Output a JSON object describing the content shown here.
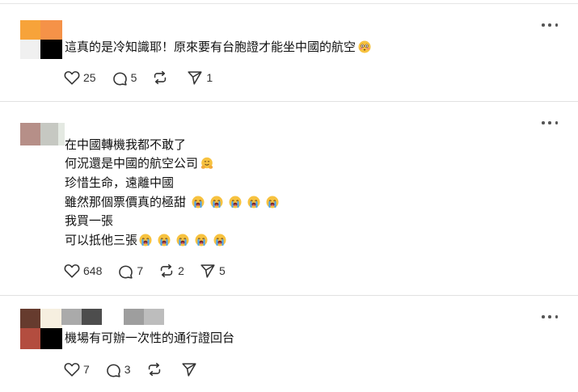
{
  "posts": [
    {
      "lines": [
        {
          "text": "這真的是冷知識耶！原來要有台胞證才能坐中國的航空",
          "emojis": [
            "flushed-face"
          ]
        }
      ],
      "counts": {
        "likes": "25",
        "replies": "5",
        "reposts": "",
        "shares": "1"
      }
    },
    {
      "lines": [
        {
          "text": "在中國轉機我都不敢了",
          "emojis": []
        },
        {
          "text": "何況還是中國的航空公司",
          "emojis": [
            "hugging-face"
          ]
        },
        {
          "text": "珍惜生命，遠離中國",
          "emojis": []
        },
        {
          "text": "雖然那個票價真的極甜",
          "emojis": [
            "loudly-crying-face",
            "loudly-crying-face",
            "loudly-crying-face",
            "loudly-crying-face",
            "loudly-crying-face"
          ]
        },
        {
          "text": "我買一張",
          "emojis": []
        },
        {
          "text": "可以抵他三張",
          "emojis": [
            "loudly-crying-face",
            "loudly-crying-face",
            "loudly-crying-face",
            "loudly-crying-face",
            "loudly-crying-face"
          ]
        }
      ],
      "counts": {
        "likes": "648",
        "replies": "7",
        "reposts": "2",
        "shares": "5"
      }
    },
    {
      "lines": [
        {
          "text": "機場有可辦一次性的通行證回台",
          "emojis": []
        }
      ],
      "counts": {
        "likes": "7",
        "replies": "3",
        "reposts": "",
        "shares": ""
      }
    }
  ],
  "icons": {
    "like": "heart-icon",
    "reply": "speech-bubble-icon",
    "repost": "repost-arrows-icon",
    "share": "send-arrow-icon",
    "more": "more-options-icon"
  },
  "colors": {
    "text": "#111111",
    "icon": "#333333",
    "divider": "#e1e1e1",
    "avatar_1": [
      "#f7a33a",
      "#f59248",
      "#f0f0f0",
      "#000000"
    ],
    "avatar_2": [
      "#b68f88",
      "#c6c8c2",
      "#e4e9e2"
    ],
    "avatar_3": [
      "#663b2e",
      "#f6efe0",
      "#b34d3f",
      "#000000"
    ],
    "name_blocks": [
      "#aaaaaa",
      "#4d4d4d",
      "#9e9e9e",
      "#bdbdbd"
    ]
  }
}
